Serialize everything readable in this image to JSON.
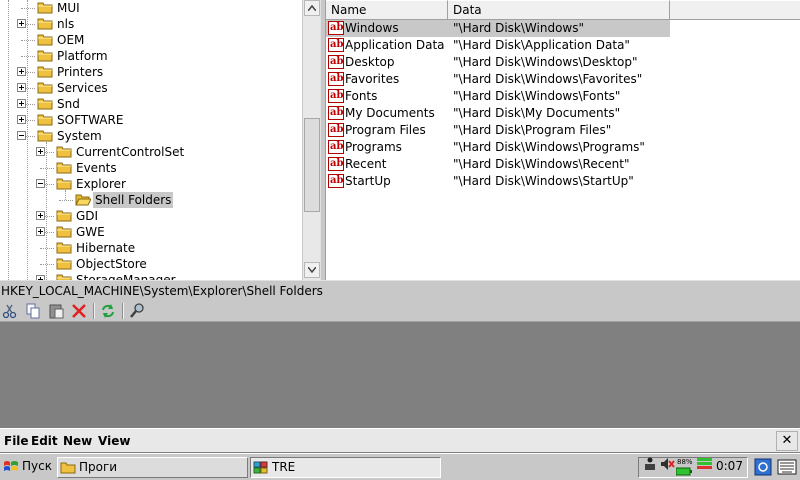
{
  "tree": {
    "items": [
      {
        "label": "MUI",
        "indent": 1,
        "expander": "none"
      },
      {
        "label": "nls",
        "indent": 1,
        "expander": "plus"
      },
      {
        "label": "OEM",
        "indent": 1,
        "expander": "none"
      },
      {
        "label": "Platform",
        "indent": 1,
        "expander": "none"
      },
      {
        "label": "Printers",
        "indent": 1,
        "expander": "plus"
      },
      {
        "label": "Services",
        "indent": 1,
        "expander": "plus"
      },
      {
        "label": "Snd",
        "indent": 1,
        "expander": "plus"
      },
      {
        "label": "SOFTWARE",
        "indent": 1,
        "expander": "plus"
      },
      {
        "label": "System",
        "indent": 1,
        "expander": "minus"
      },
      {
        "label": "CurrentControlSet",
        "indent": 2,
        "expander": "plus"
      },
      {
        "label": "Events",
        "indent": 2,
        "expander": "none"
      },
      {
        "label": "Explorer",
        "indent": 2,
        "expander": "minus"
      },
      {
        "label": "Shell Folders",
        "indent": 3,
        "expander": "none",
        "selected": true,
        "open": true
      },
      {
        "label": "GDI",
        "indent": 2,
        "expander": "plus"
      },
      {
        "label": "GWE",
        "indent": 2,
        "expander": "plus"
      },
      {
        "label": "Hibernate",
        "indent": 2,
        "expander": "none"
      },
      {
        "label": "ObjectStore",
        "indent": 2,
        "expander": "none"
      },
      {
        "label": "StorageManager",
        "indent": 2,
        "expander": "plus"
      }
    ]
  },
  "list": {
    "columns": [
      "Name",
      "Data"
    ],
    "rows": [
      {
        "name": "Windows",
        "data": "\"\\Hard Disk\\Windows\"",
        "selected": true
      },
      {
        "name": "Application Data",
        "data": "\"\\Hard Disk\\Application Data\""
      },
      {
        "name": "Desktop",
        "data": "\"\\Hard Disk\\Windows\\Desktop\""
      },
      {
        "name": "Favorites",
        "data": "\"\\Hard Disk\\Windows\\Favorites\""
      },
      {
        "name": "Fonts",
        "data": "\"\\Hard Disk\\Windows\\Fonts\""
      },
      {
        "name": "My Documents",
        "data": "\"\\Hard Disk\\My Documents\""
      },
      {
        "name": "Program Files",
        "data": "\"\\Hard Disk\\Program Files\""
      },
      {
        "name": "Programs",
        "data": "\"\\Hard Disk\\Windows\\Programs\""
      },
      {
        "name": "Recent",
        "data": "\"\\Hard Disk\\Windows\\Recent\""
      },
      {
        "name": "StartUp",
        "data": "\"\\Hard Disk\\Windows\\StartUp\""
      }
    ],
    "value_icon_text": "ab"
  },
  "path_bar": {
    "text": "HKEY_LOCAL_MACHINE\\System\\Explorer\\Shell Folders"
  },
  "toolbar": {
    "buttons": [
      "cut-icon",
      "copy-icon",
      "paste-icon",
      "delete-icon",
      "refresh-icon",
      "find-icon"
    ]
  },
  "menubar": {
    "items": [
      "File",
      "Edit",
      "New",
      "View"
    ],
    "close_label": "✕"
  },
  "taskbar": {
    "start_label": "Пуск",
    "tasks": [
      {
        "label": "Проги",
        "icon": "folder-icon"
      },
      {
        "label": "TRE",
        "icon": "registry-icon",
        "active": true
      }
    ],
    "battery": "88%",
    "clock": "0:07"
  },
  "colors": {
    "selection": "#c8c8c8",
    "folder": "#f0c040",
    "value_icon": "#c00000"
  }
}
